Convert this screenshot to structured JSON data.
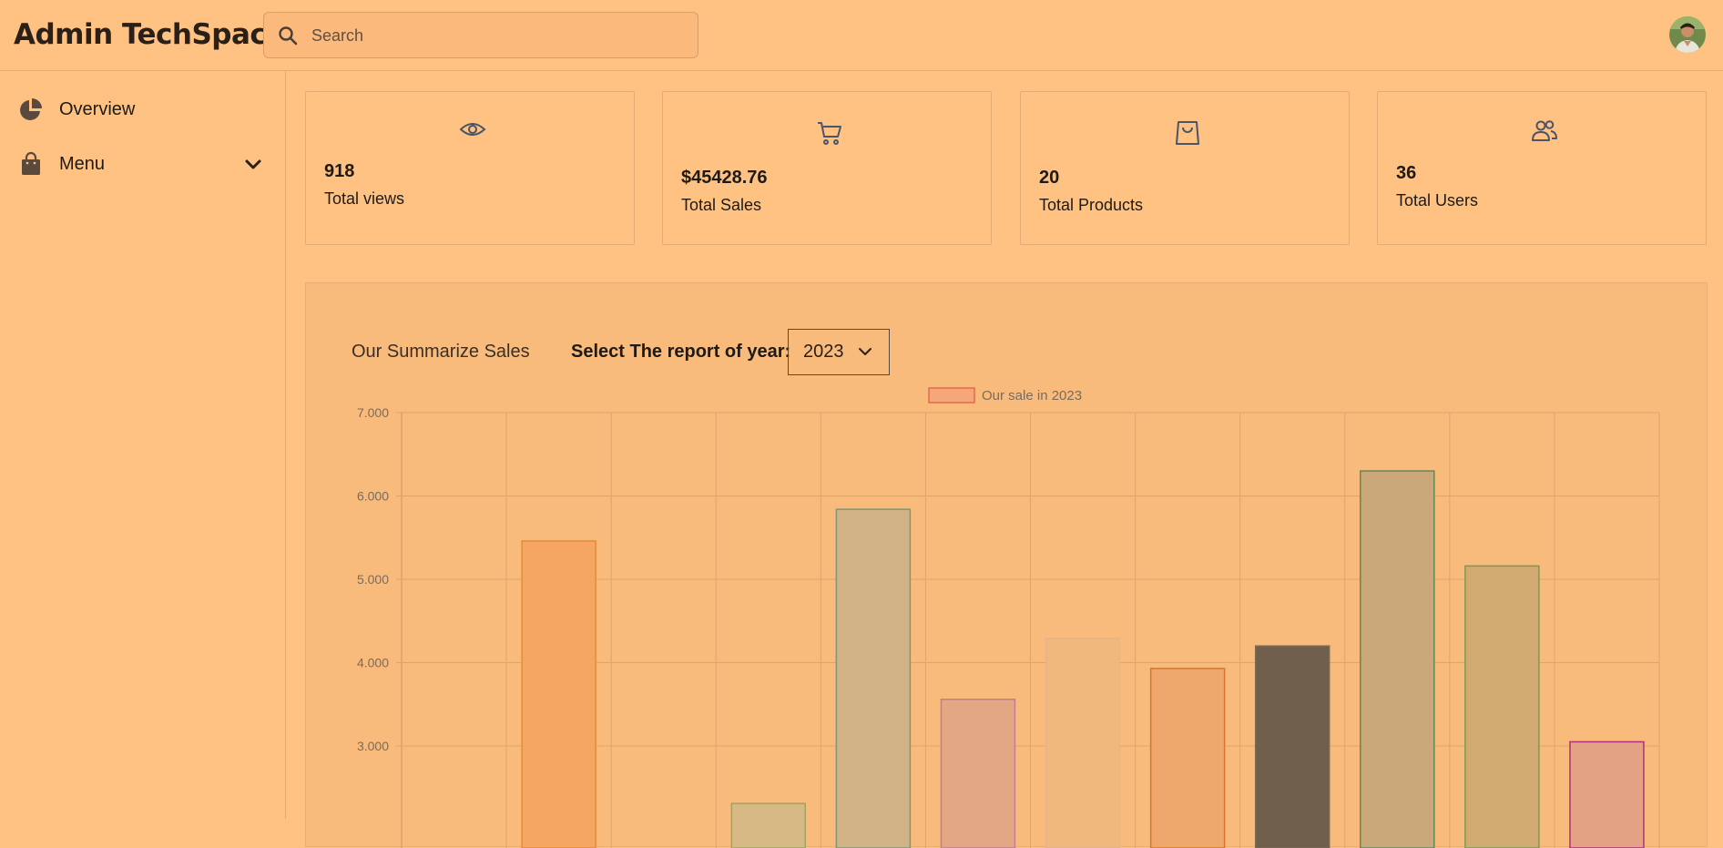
{
  "header": {
    "brand": "Admin TechSpace",
    "search_placeholder": "Search"
  },
  "sidebar": {
    "items": [
      {
        "label": "Overview",
        "icon": "pie-chart-icon"
      },
      {
        "label": "Menu",
        "icon": "shopping-bag-icon",
        "expandable": true
      }
    ]
  },
  "stats": [
    {
      "value": "918",
      "label": "Total views",
      "icon": "eye-icon"
    },
    {
      "value": "$45428.76",
      "label": "Total Sales",
      "icon": "cart-icon"
    },
    {
      "value": "20",
      "label": "Total Products",
      "icon": "bag-icon"
    },
    {
      "value": "36",
      "label": "Total Users",
      "icon": "users-icon"
    }
  ],
  "report": {
    "title": "Our Summarize Sales",
    "year_label": "Select The report of year:",
    "selected_year": "2023"
  },
  "colors": {
    "background": "#ffc283",
    "panel": "#f9bb7c",
    "icon": "#4a5568"
  },
  "chart_data": {
    "type": "bar",
    "legend": [
      "Our sale in 2023"
    ],
    "legend_placement": "top-center",
    "grid": true,
    "ylim_visible": [
      2500,
      7000
    ],
    "y_ticks": [
      "7.000",
      "6.000",
      "5.000",
      "4.000",
      "3.000"
    ],
    "y_tick_values": [
      7000,
      6000,
      5000,
      4000,
      3000
    ],
    "series": [
      {
        "name": "Our sale in 2023",
        "values": [
          null,
          5460,
          null,
          2310,
          5840,
          3560,
          4290,
          3930,
          4200,
          6300,
          5160,
          3050
        ],
        "fills": [
          "#f7a76b",
          "#f5a663",
          "#f7a76b",
          "#d6b984",
          "#d1b386",
          "#e4a784",
          "#efb97e",
          "#eea76c",
          "#6f5f4c",
          "#caa879",
          "#d2ab73",
          "#e3a283"
        ],
        "strokes": [
          "#e07a3a",
          "#e68a3a",
          "#e07a3a",
          "#a3a25f",
          "#7f9579",
          "#c07e93",
          "#e6b38a",
          "#d8762e",
          "#7a6a55",
          "#5f8a55",
          "#7a9a52",
          "#b0307a"
        ]
      }
    ]
  }
}
